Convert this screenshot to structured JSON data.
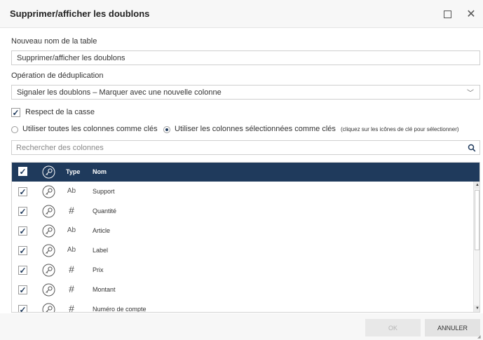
{
  "dialog": {
    "title": "Supprimer/afficher les doublons"
  },
  "table_name": {
    "label": "Nouveau nom de la table",
    "value": "Supprimer/afficher les doublons"
  },
  "dedup_operation": {
    "label": "Opération de déduplication",
    "value": "Signaler les doublons – Marquer avec une nouvelle colonne"
  },
  "case_sensitive": {
    "label": "Respect de la casse",
    "checked": true
  },
  "key_mode": {
    "option_all": "Utiliser toutes les colonnes comme clés",
    "option_selected": "Utiliser les colonnes sélectionnées comme clés",
    "selected": "option_selected",
    "hint": "(cliquez sur les icônes de clé pour sélectionner)"
  },
  "column_search": {
    "placeholder": "Rechercher des colonnes"
  },
  "grid": {
    "headers": {
      "type": "Type",
      "name": "Nom"
    },
    "rows": [
      {
        "type": "Ab",
        "name": "Support",
        "checked": true
      },
      {
        "type": "#",
        "name": "Quantité",
        "checked": true
      },
      {
        "type": "Ab",
        "name": "Article",
        "checked": true
      },
      {
        "type": "Ab",
        "name": "Label",
        "checked": true
      },
      {
        "type": "#",
        "name": "Prix",
        "checked": true
      },
      {
        "type": "#",
        "name": "Montant",
        "checked": true
      },
      {
        "type": "#",
        "name": "Numéro de compte",
        "checked": true
      }
    ]
  },
  "buttons": {
    "ok": "OK",
    "cancel": "ANNULER"
  },
  "colors": {
    "header_bg": "#1f3a5c",
    "accent": "#1f3a5c"
  },
  "icons": {
    "close": "close-icon",
    "maximize": "maximize-icon",
    "search": "search-icon",
    "key": "key-icon",
    "chevron": "chevron-down-icon",
    "check": "check-icon"
  }
}
